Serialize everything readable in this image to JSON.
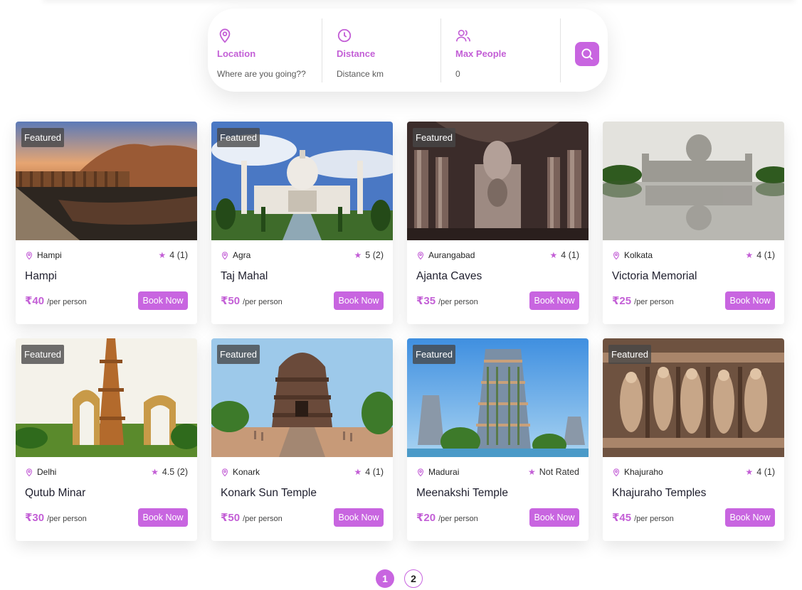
{
  "search": {
    "location": {
      "label": "Location",
      "placeholder": "Where are you going??"
    },
    "distance": {
      "label": "Distance",
      "placeholder": "Distance km"
    },
    "max_people": {
      "label": "Max People",
      "placeholder": "0"
    }
  },
  "tours": [
    {
      "badge": "Featured",
      "city": "Hampi",
      "rating": "4 (1)",
      "title": "Hampi",
      "price": "₹40",
      "per": "/per person",
      "cta": "Book Now"
    },
    {
      "badge": "Featured",
      "city": "Agra",
      "rating": "5 (2)",
      "title": "Taj Mahal",
      "price": "₹50",
      "per": "/per person",
      "cta": "Book Now"
    },
    {
      "badge": "Featured",
      "city": "Aurangabad",
      "rating": "4 (1)",
      "title": "Ajanta Caves",
      "price": "₹35",
      "per": "/per person",
      "cta": "Book Now"
    },
    {
      "badge": "",
      "city": "Kolkata",
      "rating": "4 (1)",
      "title": "Victoria Memorial",
      "price": "₹25",
      "per": "/per person",
      "cta": "Book Now"
    },
    {
      "badge": "Featured",
      "city": "Delhi",
      "rating": "4.5 (2)",
      "title": "Qutub Minar",
      "price": "₹30",
      "per": "/per person",
      "cta": "Book Now"
    },
    {
      "badge": "Featured",
      "city": "Konark",
      "rating": "4 (1)",
      "title": "Konark Sun Temple",
      "price": "₹50",
      "per": "/per person",
      "cta": "Book Now"
    },
    {
      "badge": "Featured",
      "city": "Madurai",
      "rating": "Not Rated",
      "title": "Meenakshi Temple",
      "price": "₹20",
      "per": "/per person",
      "cta": "Book Now"
    },
    {
      "badge": "Featured",
      "city": "Khajuraho",
      "rating": "4 (1)",
      "title": "Khajuraho Temples",
      "price": "₹45",
      "per": "/per person",
      "cta": "Book Now"
    }
  ],
  "pagination": {
    "pages": [
      "1",
      "2"
    ],
    "active": "1"
  },
  "colors": {
    "accent": "#c865e0",
    "accent_text": "#c35fd6"
  },
  "icons": {
    "location": "map-pin-icon",
    "distance": "clock-icon",
    "people": "users-icon",
    "search": "search-icon",
    "rating": "star-icon"
  }
}
